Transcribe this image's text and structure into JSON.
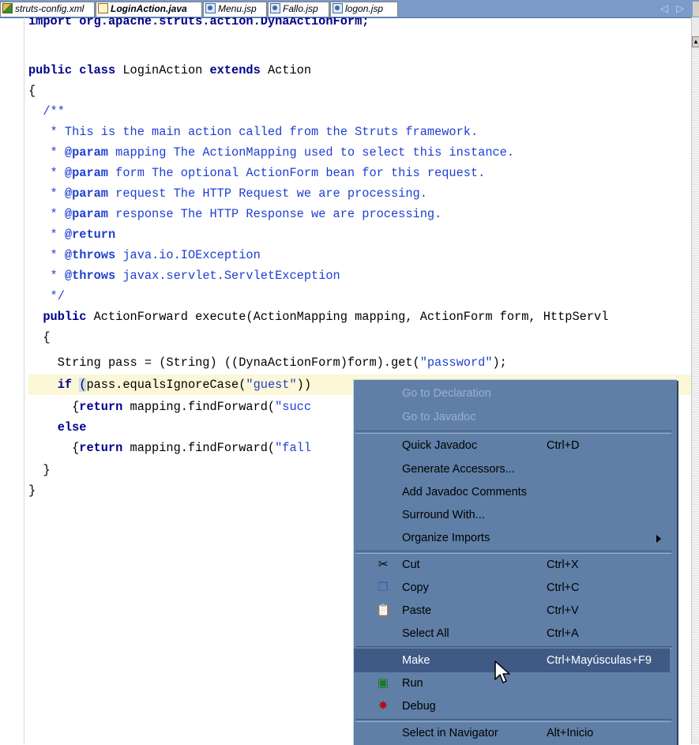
{
  "tabs": [
    {
      "label": "struts-config.xml",
      "icon": "xml-file-icon"
    },
    {
      "label": "LoginAction.java",
      "icon": "java-file-icon",
      "active": true
    },
    {
      "label": "Menu.jsp",
      "icon": "jsp-file-icon"
    },
    {
      "label": "Fallo.jsp",
      "icon": "jsp-file-icon"
    },
    {
      "label": "logon.jsp",
      "icon": "jsp-file-icon"
    }
  ],
  "code": {
    "l1": "import org.apache.struts.action.DynaActionForm;",
    "l2_kw": "public class",
    "l2_mid": " LoginAction ",
    "l2_kw2": "extends",
    "l2_end": " Action",
    "l3": "{",
    "l4": "  /**",
    "l5": "   * This is the main action called from the Struts framework.",
    "l6_tag": "@param",
    "l6_text": " mapping The ActionMapping used to select this instance.",
    "l7_tag": "@param",
    "l7_text": " form The optional ActionForm bean for this request.",
    "l8_tag": "@param",
    "l8_text": " request The HTTP Request we are processing.",
    "l9_tag": "@param",
    "l9_text": " response The HTTP Response we are processing.",
    "l10_tag": "@return",
    "l11_tag": "@throws",
    "l11_text": " java.io.IOException",
    "l12_tag": "@throws",
    "l12_text": " javax.servlet.ServletException",
    "l13": "   */",
    "l14_kw": "public",
    "l14_text": " ActionForward execute(ActionMapping mapping, ActionForm form, HttpServl",
    "l15": "  {",
    "l16_a": "    String pass = (String) ((DynaActionForm)form).get(",
    "l16_s": "\"password\"",
    "l16_b": ");",
    "l17_kw": "if",
    "l17_a": "(",
    "l17_b": "pass.equalsIgnoreCase(",
    "l17_s": "\"guest\"",
    "l17_c": "))",
    "l18_a": "      {",
    "l18_kw": "return",
    "l18_b": " mapping.findForward(",
    "l18_s": "\"succ",
    "l19_kw": "else",
    "l20_a": "      {",
    "l20_kw": "return",
    "l20_b": " mapping.findForward(",
    "l20_s": "\"fall",
    "l21": "  }",
    "l22": "}"
  },
  "menu": {
    "go_declaration": "Go to Declaration",
    "go_javadoc": "Go to Javadoc",
    "quick_javadoc": "Quick Javadoc",
    "quick_javadoc_key": "Ctrl+D",
    "generate_accessors": "Generate Accessors...",
    "add_javadoc": "Add Javadoc Comments",
    "surround_with": "Surround With...",
    "organize_imports": "Organize Imports",
    "cut": "Cut",
    "cut_key": "Ctrl+X",
    "copy": "Copy",
    "copy_key": "Ctrl+C",
    "paste": "Paste",
    "paste_key": "Ctrl+V",
    "select_all": "Select All",
    "select_all_key": "Ctrl+A",
    "make": "Make",
    "make_key": "Ctrl+Mayúsculas+F9",
    "run": "Run",
    "debug": "Debug",
    "select_navigator": "Select in Navigator",
    "select_navigator_key": "Alt+Inicio"
  },
  "colors": {
    "menu_bg": "#5f7fa6",
    "menu_selected": "#3f5b85",
    "keyword": "#00008b",
    "comment": "#1e3fd2",
    "tabbar": "#7b9cc9"
  }
}
